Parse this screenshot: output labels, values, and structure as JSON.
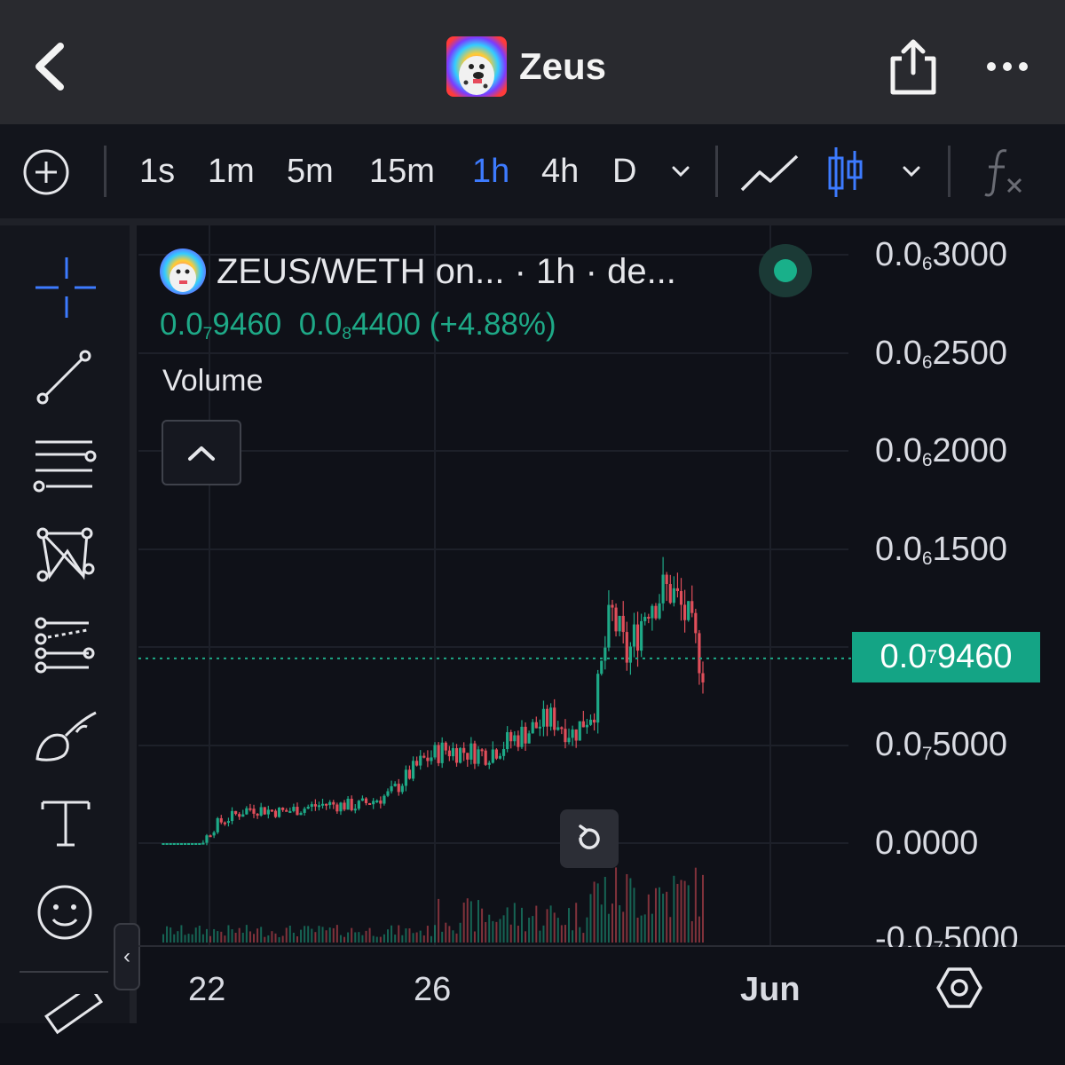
{
  "header": {
    "title": "Zeus"
  },
  "toolbar": {
    "intervals": [
      "1s",
      "1m",
      "5m",
      "15m",
      "1h",
      "4h",
      "D"
    ],
    "active_interval": "1h"
  },
  "chart_header": {
    "symbol_text": "ZEUS/WETH on...  · 1h · de...",
    "ohlc": {
      "last_prefix": "0.0",
      "last_sub": "7",
      "last_rest": "9460",
      "change_prefix": "0.0",
      "change_sub": "8",
      "change_rest": "4400",
      "change_pct": "(+4.88%)"
    },
    "volume_label": "Volume"
  },
  "y_axis": [
    {
      "prefix": "0.0",
      "sub": "6",
      "rest": "3000"
    },
    {
      "prefix": "0.0",
      "sub": "6",
      "rest": "2500"
    },
    {
      "prefix": "0.0",
      "sub": "6",
      "rest": "2000"
    },
    {
      "prefix": "0.0",
      "sub": "6",
      "rest": "1500"
    },
    {
      "prefix": "0.0",
      "sub": "7",
      "rest": "5000"
    },
    {
      "prefix": "0.0000",
      "sub": "",
      "rest": ""
    },
    {
      "prefix": "-0.0",
      "sub": "7",
      "rest": "5000"
    }
  ],
  "price_tag": {
    "prefix": "0.0",
    "sub": "7",
    "rest": "9460"
  },
  "x_axis": [
    "22",
    "26",
    "Jun"
  ],
  "colors": {
    "up": "#1ea987",
    "down": "#e04e5a",
    "accent": "#3d7bff",
    "tag": "#14a485"
  },
  "chart_data": {
    "type": "candlestick",
    "title": "ZEUS/WETH",
    "interval": "1h",
    "x_ticks": [
      "22",
      "26",
      "Jun"
    ],
    "y_ticks": [
      3e-07,
      2.5e-07,
      2e-07,
      1.5e-07,
      5e-08,
      0,
      -5e-08
    ],
    "last_price": 9.46e-08,
    "change": 4.4e-09,
    "change_pct": 4.88,
    "trend": [
      {
        "t": 0,
        "p": 0.0
      },
      {
        "t": 0.07,
        "p": 0.0
      },
      {
        "t": 0.1,
        "p": 1e-08
      },
      {
        "t": 0.16,
        "p": 1.8e-08
      },
      {
        "t": 0.22,
        "p": 1.6e-08
      },
      {
        "t": 0.3,
        "p": 2e-08
      },
      {
        "t": 0.36,
        "p": 1.9e-08
      },
      {
        "t": 0.42,
        "p": 2.5e-08
      },
      {
        "t": 0.48,
        "p": 4.2e-08
      },
      {
        "t": 0.52,
        "p": 4.8e-08
      },
      {
        "t": 0.6,
        "p": 4.6e-08
      },
      {
        "t": 0.66,
        "p": 5.5e-08
      },
      {
        "t": 0.72,
        "p": 6.4e-08
      },
      {
        "t": 0.76,
        "p": 5.6e-08
      },
      {
        "t": 0.8,
        "p": 7e-08
      },
      {
        "t": 0.83,
        "p": 1.18e-07
      },
      {
        "t": 0.86,
        "p": 9.5e-08
      },
      {
        "t": 0.9,
        "p": 1.25e-07
      },
      {
        "t": 0.94,
        "p": 1.3e-07
      },
      {
        "t": 0.97,
        "p": 1.15e-07
      },
      {
        "t": 1.0,
        "p": 9e-08
      }
    ]
  }
}
